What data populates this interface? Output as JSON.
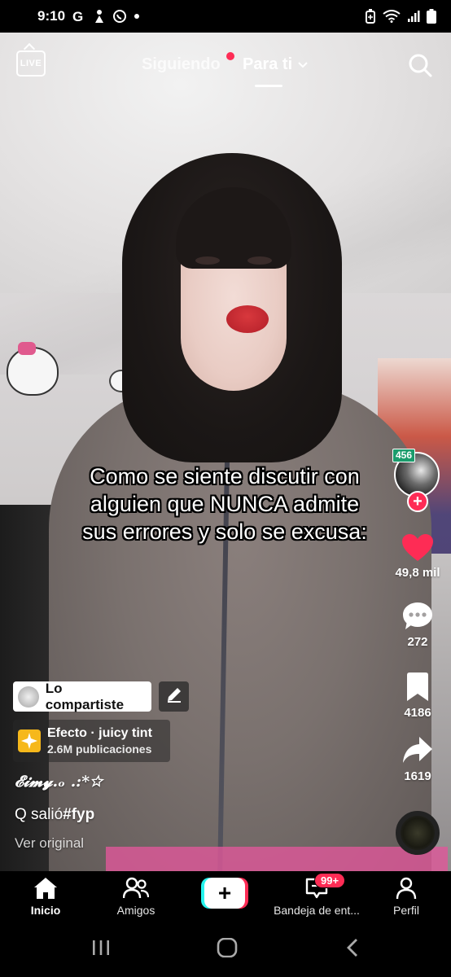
{
  "status_bar": {
    "time": "9:10",
    "left_icons": [
      "google-icon",
      "activity-icon",
      "whatsapp-icon",
      "dot-icon"
    ],
    "right_icons": [
      "battery-saver-icon",
      "wifi-icon",
      "signal-icon",
      "battery-icon"
    ]
  },
  "top_nav": {
    "live_label": "LIVE",
    "tab_following": "Siguiendo",
    "tab_for_you": "Para ti",
    "following_has_new": true
  },
  "video": {
    "overlay_text_lines": [
      "Como se siente discutir con",
      "alguien que NUNCA admite",
      "sus errores y solo se excusa:"
    ]
  },
  "right_rail": {
    "avatar_badge": "456",
    "likes": "49,8 mil",
    "comments": "272",
    "saves": "4186",
    "shares": "1619",
    "like_color": "#fe2c55"
  },
  "post_info": {
    "shared_label": "Lo compartiste",
    "effect_title": "Efecto · juicy tint",
    "effect_subtitle": "2.6M publicaciones",
    "username": "𝓔𝓲𝓶𝔂.ₒ .:*☆",
    "caption_text": "Q salió",
    "caption_hashtag": "#fyp",
    "see_original": "Ver original"
  },
  "bottom_nav": {
    "home": "Inicio",
    "friends": "Amigos",
    "inbox": "Bandeja de ent...",
    "inbox_badge": "99+",
    "profile": "Perfil"
  },
  "colors": {
    "accent_red": "#fe2c55",
    "accent_cyan": "#25f4ee",
    "badge_green": "#1b9c6c"
  }
}
